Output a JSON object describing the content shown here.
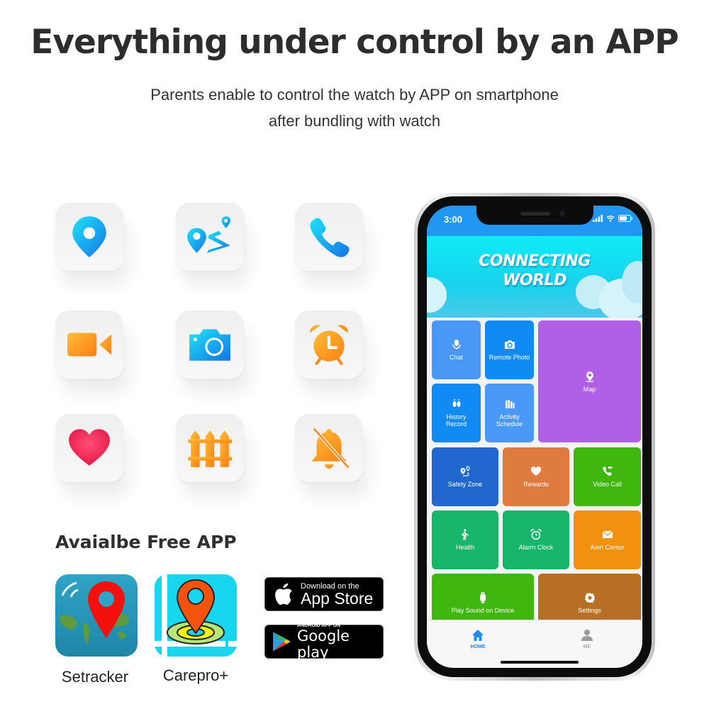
{
  "headline": "Everything under control by an APP",
  "subtext": [
    "Parents enable to control the watch by APP on smartphone",
    "after bundling with watch"
  ],
  "feature_icons": [
    {
      "name": "location-pin-icon",
      "color": "#1aa7f0"
    },
    {
      "name": "route-icon",
      "color": "#1aa7f0"
    },
    {
      "name": "phone-call-icon",
      "color": "#1aa7f0"
    },
    {
      "name": "video-camera-icon",
      "color": "#fb9a1a"
    },
    {
      "name": "photo-camera-icon",
      "color": "#1aa7f0"
    },
    {
      "name": "alarm-clock-icon",
      "color": "#fb9a1a"
    },
    {
      "name": "heart-icon",
      "color": "#f4385f"
    },
    {
      "name": "fence-icon",
      "color": "#fb9a1a"
    },
    {
      "name": "bell-off-icon",
      "color": "#fb9a1a"
    }
  ],
  "available": {
    "title": "Avaialbe Free APP",
    "apps": [
      {
        "name": "Setracker"
      },
      {
        "name": "Carepro+"
      }
    ],
    "stores": {
      "appstore": {
        "small": "Download on the",
        "big": "App Store"
      },
      "googleplay": {
        "small": "ANDROID APP ON",
        "big": "Google play"
      }
    }
  },
  "phone": {
    "status_time": "3:00",
    "banner": [
      "CONNECTING",
      "WORLD"
    ],
    "cards": [
      {
        "label": "Chat",
        "color": "#4a98f6",
        "icon": "microphone-icon"
      },
      {
        "label": "Remote Photo",
        "color": "#118af4",
        "icon": "camera-icon"
      },
      {
        "label": "Map",
        "color": "#b060e6",
        "icon": "map-pin-icon"
      },
      {
        "label": "History Record",
        "color": "#118af4",
        "icon": "footprints-icon"
      },
      {
        "label": "Activity Schedule",
        "color": "#4a98f6",
        "icon": "schedule-icon"
      },
      {
        "label": "Safety Zone",
        "color": "#2266cf",
        "icon": "safety-zone-icon"
      },
      {
        "label": "Rewards",
        "color": "#e07b40",
        "icon": "heart-icon"
      },
      {
        "label": "Video Call",
        "color": "#3fb70e",
        "icon": "video-call-icon"
      },
      {
        "label": "Health",
        "color": "#17b66a",
        "icon": "walking-icon"
      },
      {
        "label": "Alarm Clock",
        "color": "#17b66a",
        "icon": "alarm-icon"
      },
      {
        "label": "Alert Center",
        "color": "#f1910f",
        "icon": "envelope-icon"
      },
      {
        "label": "Play Sound on Device",
        "color": "#3fb70e",
        "icon": "watch-icon"
      },
      {
        "label": "Settings",
        "color": "#b76f24",
        "icon": "gear-icon"
      }
    ],
    "tabs": [
      {
        "label": "HOME",
        "active": true,
        "color": "#1c8cf0"
      },
      {
        "label": "ME",
        "active": false,
        "color": "#8a8a8a"
      }
    ]
  }
}
